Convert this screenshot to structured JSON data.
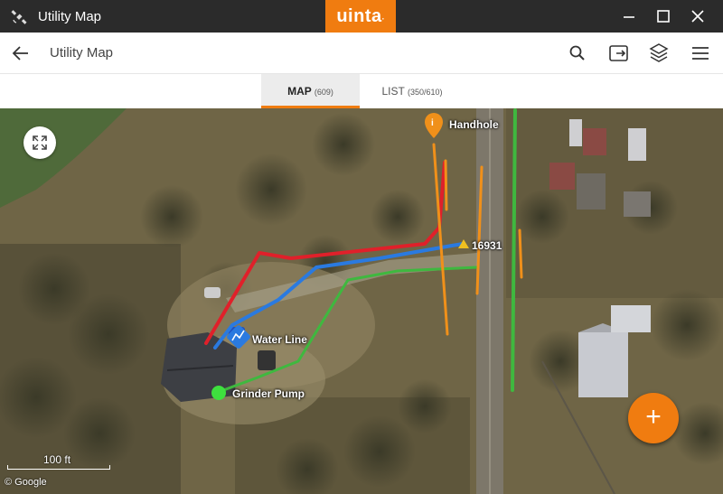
{
  "window": {
    "title": "Utility Map",
    "brand": "uinta"
  },
  "appbar": {
    "title": "Utility Map"
  },
  "tabs": [
    {
      "label": "MAP",
      "count": "(609)"
    },
    {
      "label": "LIST",
      "count": "(350/610)"
    }
  ],
  "map": {
    "labels": {
      "handhole": "Handhole",
      "node": "16931",
      "water_line": "Water Line",
      "grinder_pump": "Grinder Pump"
    },
    "scale": "100 ft",
    "attribution": "© Google",
    "colors": {
      "red_line": "#e0202a",
      "blue_line": "#2a7ae0",
      "green_line": "#3fb83f",
      "orange_line": "#f0901a",
      "accent": "#f07c10"
    }
  },
  "icons": {
    "app": "satellite-icon",
    "back": "arrow-left-icon",
    "search": "search-icon",
    "export": "export-icon",
    "layers": "layers-icon",
    "menu": "hamburger-icon",
    "expand": "expand-icon",
    "add": "plus-icon"
  },
  "fab_label": "+"
}
